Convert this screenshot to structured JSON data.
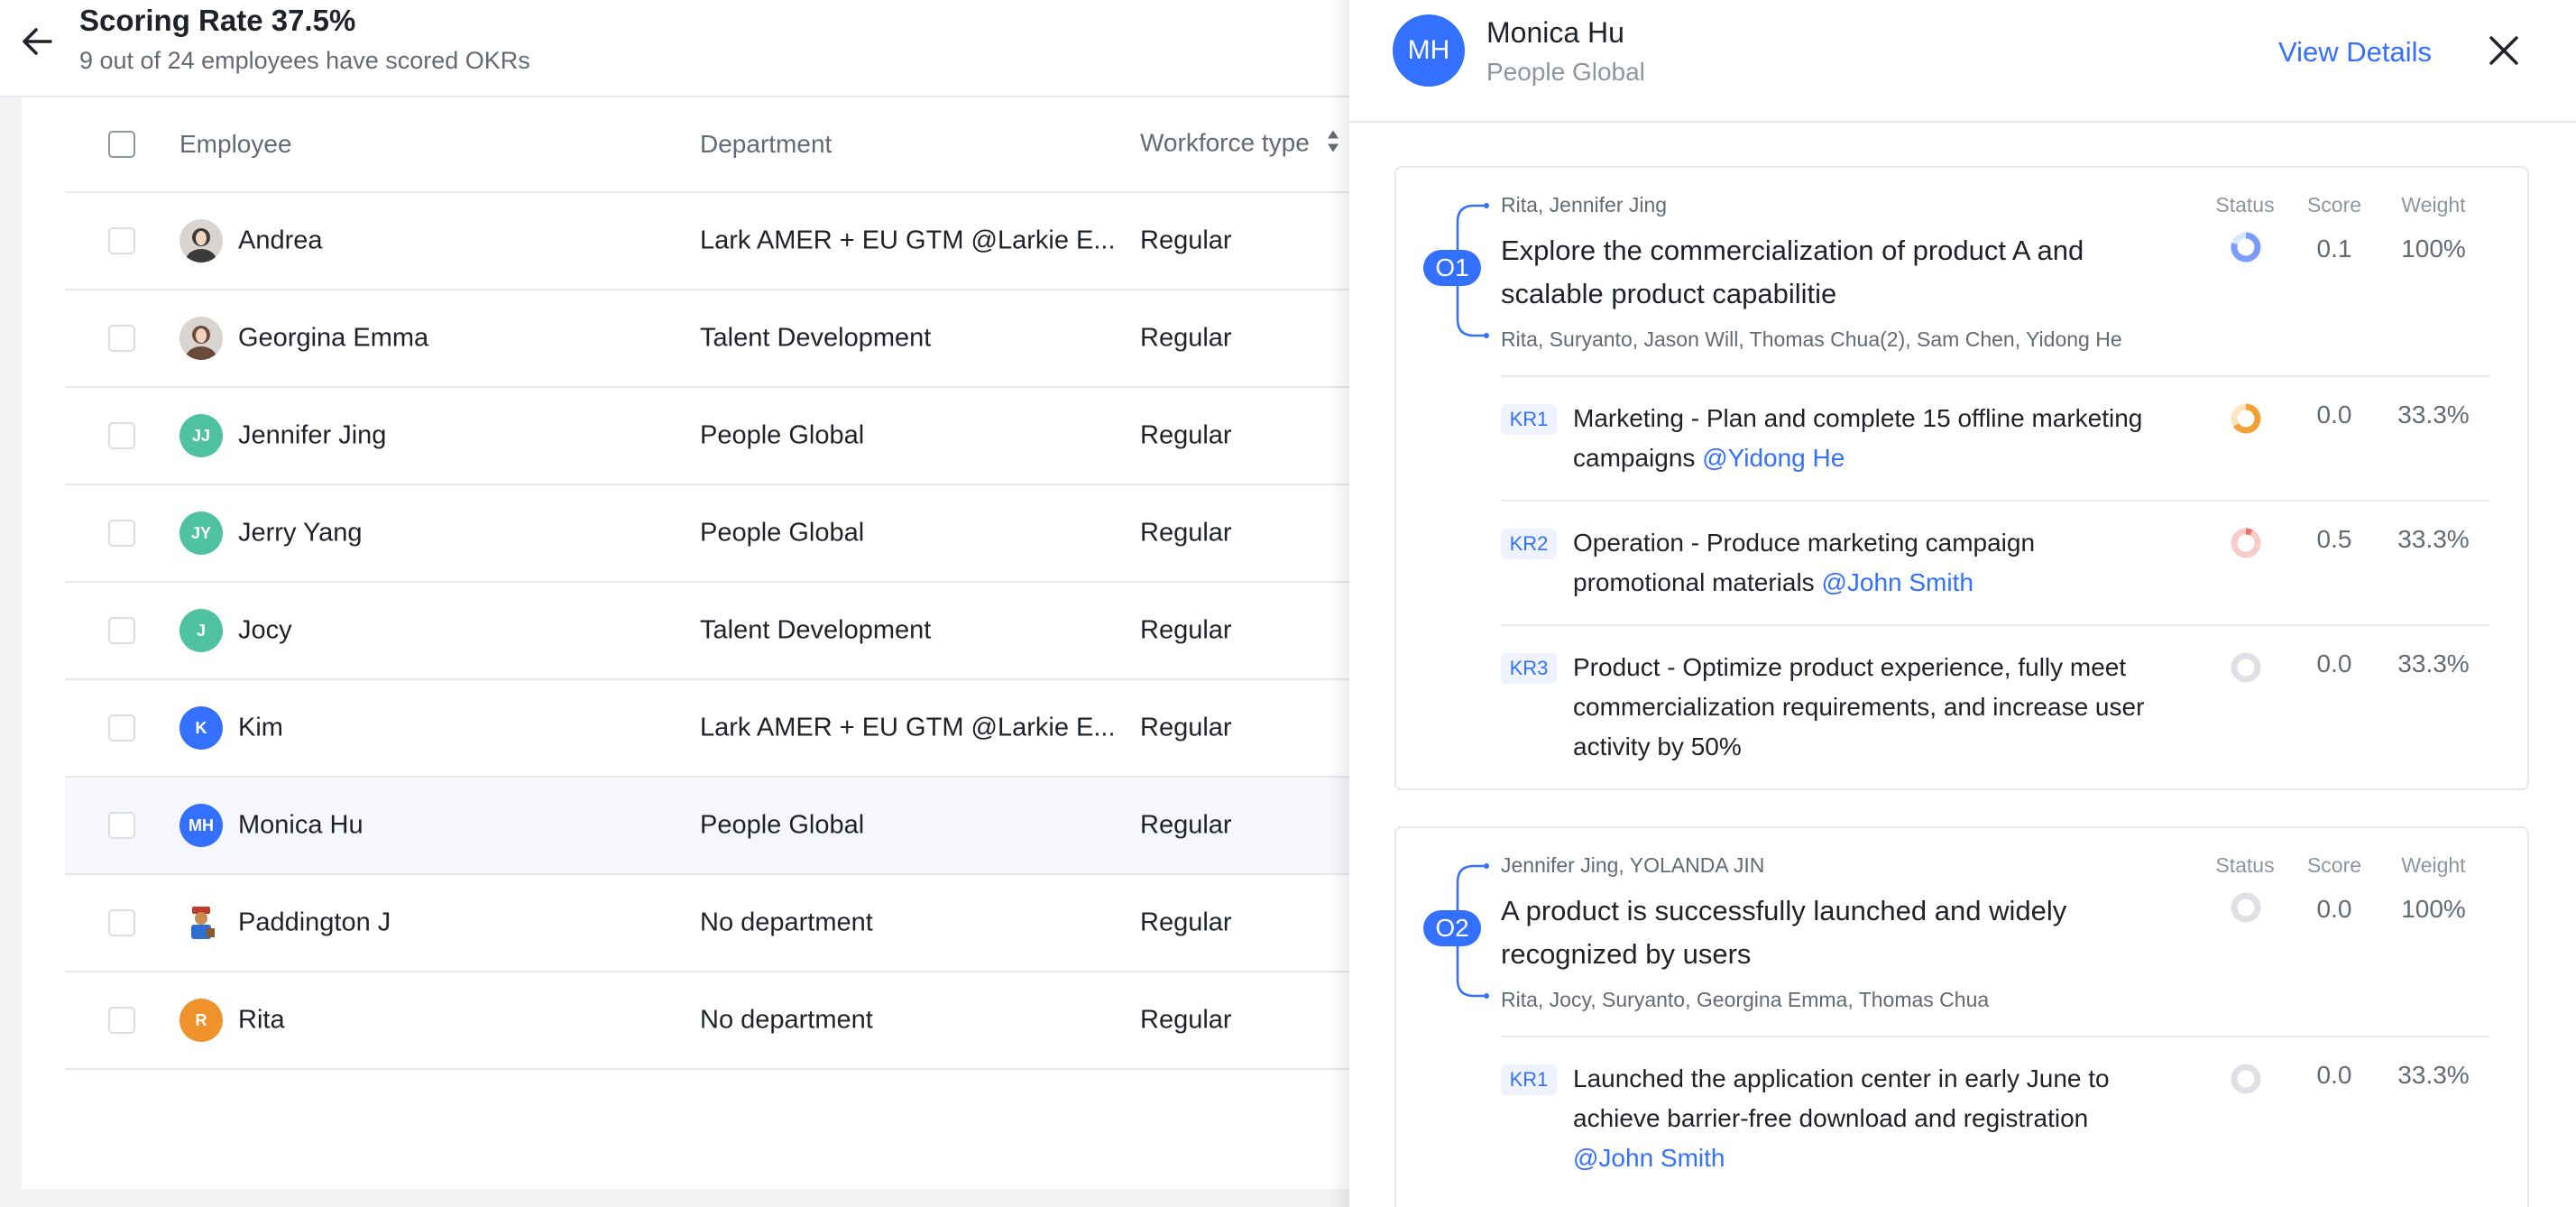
{
  "header": {
    "title": "Scoring Rate 37.5%",
    "subtitle": "9 out of 24 employees have scored OKRs"
  },
  "table": {
    "columns": {
      "employee": "Employee",
      "department": "Department",
      "workforce_type": "Workforce type"
    },
    "rows": [
      {
        "name": "Andrea",
        "department": "Lark AMER + EU GTM @Larkie E...",
        "type": "Regular",
        "avatar": {
          "kind": "photo",
          "initials": "",
          "color": "#3a3a3a"
        }
      },
      {
        "name": "Georgina Emma",
        "department": "Talent Development",
        "type": "Regular",
        "avatar": {
          "kind": "photo",
          "initials": "",
          "color": "#6b4a3a"
        }
      },
      {
        "name": "Jennifer Jing",
        "department": "People Global",
        "type": "Regular",
        "avatar": {
          "kind": "initials",
          "initials": "JJ",
          "color": "#4fc3a1"
        }
      },
      {
        "name": "Jerry Yang",
        "department": "People Global",
        "type": "Regular",
        "avatar": {
          "kind": "initials",
          "initials": "JY",
          "color": "#4fc3a1"
        }
      },
      {
        "name": "Jocy",
        "department": "Talent Development",
        "type": "Regular",
        "avatar": {
          "kind": "initials",
          "initials": "J",
          "color": "#4fc3a1"
        }
      },
      {
        "name": "Kim",
        "department": "Lark AMER + EU GTM @Larkie E...",
        "type": "Regular",
        "avatar": {
          "kind": "initials",
          "initials": "K",
          "color": "#3370ff"
        }
      },
      {
        "name": "Monica Hu",
        "department": "People Global",
        "type": "Regular",
        "avatar": {
          "kind": "initials",
          "initials": "MH",
          "color": "#3370ff"
        }
      },
      {
        "name": "Paddington J",
        "department": "No department",
        "type": "Regular",
        "avatar": {
          "kind": "illustration",
          "initials": "",
          "color": "#c0392b"
        }
      },
      {
        "name": "Rita",
        "department": "No department",
        "type": "Regular",
        "avatar": {
          "kind": "initials",
          "initials": "R",
          "color": "#f0922b"
        }
      }
    ]
  },
  "drawer": {
    "avatar_initials": "MH",
    "name": "Monica Hu",
    "department": "People Global",
    "view_details": "View Details",
    "column_labels": {
      "status": "Status",
      "score": "Score",
      "weight": "Weight"
    },
    "objectives": [
      {
        "badge": "O1",
        "parents": "Rita, Jennifer Jing",
        "title": "Explore the commercialization of product A and scalable product capabilitie",
        "aligned": "Rita, Suryanto, Jason Will, Thomas Chua(2), Sam Chen, Yidong He",
        "score": "0.1",
        "weight": "100%",
        "krs": [
          {
            "badge": "KR1",
            "text": "Marketing - Plan and complete 15 offline marketing campaigns",
            "mention": "@Yidong He",
            "score": "0.0",
            "weight": "33.3%"
          },
          {
            "badge": "KR2",
            "text": " Operation - Produce marketing campaign promotional materials",
            "mention": "@John Smith",
            "score": "0.5",
            "weight": "33.3%"
          },
          {
            "badge": "KR3",
            "text": "Product - Optimize product experience, fully meet commercialization requirements, and increase user activity by 50%",
            "mention": "",
            "score": "0.0",
            "weight": "33.3%"
          }
        ]
      },
      {
        "badge": "O2",
        "parents": "Jennifer Jing, YOLANDA JIN",
        "title": "A product is successfully launched and widely recognized by users",
        "aligned": "Rita, Jocy, Suryanto, Georgina Emma, Thomas Chua",
        "score": "0.0",
        "weight": "100%",
        "krs": [
          {
            "badge": "KR1",
            "text": "Launched the application center in early June to achieve barrier-free download and registration",
            "mention": "@John Smith",
            "score": "0.0",
            "weight": "33.3%"
          }
        ]
      }
    ]
  },
  "colors": {
    "accent": "#3370ff",
    "ring_blue": "#7b9cff",
    "ring_orange": "#f5a037",
    "ring_red": "#e8776d",
    "ring_grey": "#dee0e3"
  }
}
